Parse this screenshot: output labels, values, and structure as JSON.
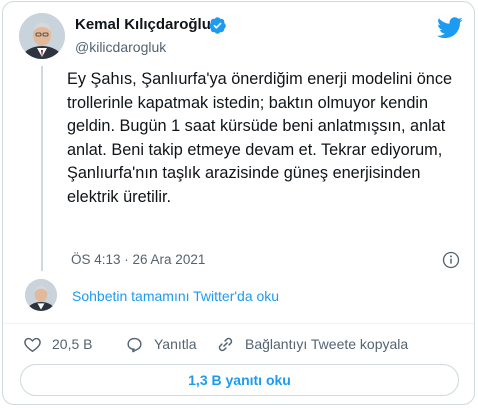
{
  "author": {
    "display_name": "Kemal Kılıçdaroğlu",
    "handle": "@kilicdarogluk"
  },
  "tweet": {
    "text": "Ey Şahıs, Şanlıurfa'ya önerdiğim enerji modelini önce trollerinle kapatmak istedin; baktın olmuyor kendin geldin. Bugün 1 saat kürsüde beni anlatmışsın, anlat anlat. Beni takip etmeye devam et. Tekrar ediyorum, Şanlıurfa'nın taşlık arazisinde güneş enerjisinden elektrik üretilir.",
    "timestamp": "ÖS 4:13 · 26 Ara 2021"
  },
  "thread": {
    "read_link": "Sohbetin tamamını Twitter'da oku"
  },
  "actions": {
    "like_count": "20,5 B",
    "reply_label": "Yanıtla",
    "copy_link_label": "Bağlantıyı Tweete kopyala"
  },
  "replies_button": {
    "label": "1,3 B yanıtı oku"
  },
  "colors": {
    "accent": "#1d9bf0",
    "secondary_text": "#536471",
    "border": "#cfd9de"
  },
  "icons": [
    "verified-badge-icon",
    "twitter-bird-icon",
    "info-icon",
    "heart-icon",
    "reply-icon",
    "link-icon"
  ]
}
